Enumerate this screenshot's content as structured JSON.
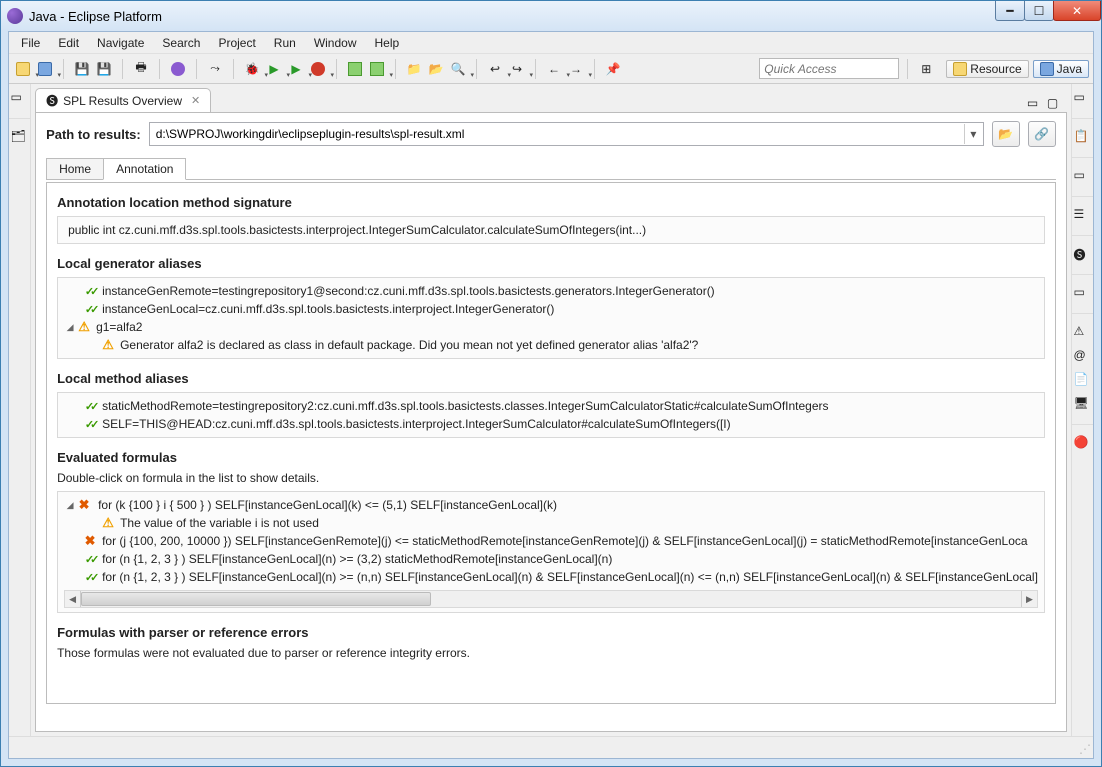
{
  "window": {
    "title": "Java - Eclipse Platform"
  },
  "menu": [
    "File",
    "Edit",
    "Navigate",
    "Search",
    "Project",
    "Run",
    "Window",
    "Help"
  ],
  "quick_access_placeholder": "Quick Access",
  "perspectives": {
    "resource": "Resource",
    "java": "Java"
  },
  "view": {
    "tab_label": "SPL Results Overview",
    "path_label": "Path to results:",
    "path_value": "d:\\SWPROJ\\workingdir\\eclipseplugin-results\\spl-result.xml",
    "subtabs": {
      "home": "Home",
      "annotation": "Annotation"
    }
  },
  "annotation": {
    "loc_heading": "Annotation location method signature",
    "signature": "public int cz.cuni.mff.d3s.spl.tools.basictests.interproject.IntegerSumCalculator.calculateSumOfIntegers(int...)",
    "gen_heading": "Local generator aliases",
    "gen_items": [
      {
        "status": "ok",
        "text": "instanceGenRemote=testingrepository1@second:cz.cuni.mff.d3s.spl.tools.basictests.generators.IntegerGenerator()"
      },
      {
        "status": "ok",
        "text": "instanceGenLocal=cz.cuni.mff.d3s.spl.tools.basictests.interproject.IntegerGenerator()"
      },
      {
        "status": "warn",
        "text": "g1=alfa2",
        "expanded": true,
        "detail": "Generator alfa2 is declared as class in default package. Did you mean not yet defined generator alias 'alfa2'?"
      }
    ],
    "meth_heading": "Local method aliases",
    "meth_items": [
      {
        "status": "ok",
        "text": "staticMethodRemote=testingrepository2:cz.cuni.mff.d3s.spl.tools.basictests.classes.IntegerSumCalculatorStatic#calculateSumOfIntegers"
      },
      {
        "status": "ok",
        "text": "SELF=THIS@HEAD:cz.cuni.mff.d3s.spl.tools.basictests.interproject.IntegerSumCalculator#calculateSumOfIntegers([I)"
      }
    ],
    "eval_heading": "Evaluated formulas",
    "eval_hint": "Double-click on formula in the list to show details.",
    "formulas": [
      {
        "status": "fail",
        "expanded": true,
        "selected": true,
        "text": "for (k {100 } i { 500 } ) SELF[instanceGenLocal](k) <= (5,1) SELF[instanceGenLocal](k)",
        "detail": "The value of the variable i is not used"
      },
      {
        "status": "fail",
        "text": "for (j {100, 200, 10000 }) SELF[instanceGenRemote](j) <= staticMethodRemote[instanceGenRemote](j) & SELF[instanceGenLocal](j) = staticMethodRemote[instanceGenLoca"
      },
      {
        "status": "ok",
        "text": "for (n {1, 2, 3 } ) SELF[instanceGenLocal](n) >= (3,2) staticMethodRemote[instanceGenLocal](n)"
      },
      {
        "status": "ok",
        "text": "for (n {1, 2, 3 } ) SELF[instanceGenLocal](n) >= (n,n) SELF[instanceGenLocal](n) & SELF[instanceGenLocal](n) <= (n,n) SELF[instanceGenLocal](n) & SELF[instanceGenLocal]"
      }
    ],
    "err_heading": "Formulas with parser or reference errors",
    "err_hint": "Those formulas were not evaluated due to parser or reference integrity errors."
  }
}
